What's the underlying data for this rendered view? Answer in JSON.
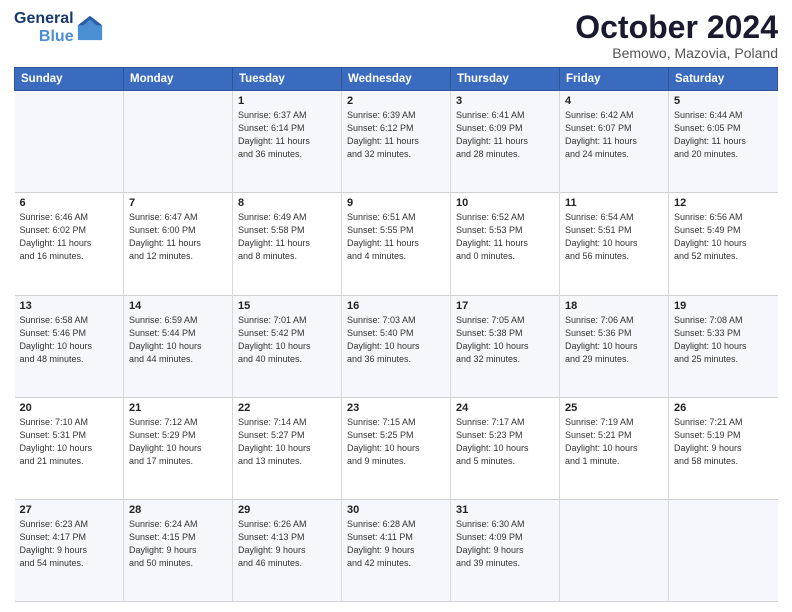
{
  "logo": {
    "text_general": "General",
    "text_blue": "Blue"
  },
  "header": {
    "title": "October 2024",
    "subtitle": "Bemowo, Mazovia, Poland"
  },
  "days_of_week": [
    "Sunday",
    "Monday",
    "Tuesday",
    "Wednesday",
    "Thursday",
    "Friday",
    "Saturday"
  ],
  "weeks": [
    [
      {
        "day": "",
        "content": ""
      },
      {
        "day": "",
        "content": ""
      },
      {
        "day": "1",
        "content": "Sunrise: 6:37 AM\nSunset: 6:14 PM\nDaylight: 11 hours\nand 36 minutes."
      },
      {
        "day": "2",
        "content": "Sunrise: 6:39 AM\nSunset: 6:12 PM\nDaylight: 11 hours\nand 32 minutes."
      },
      {
        "day": "3",
        "content": "Sunrise: 6:41 AM\nSunset: 6:09 PM\nDaylight: 11 hours\nand 28 minutes."
      },
      {
        "day": "4",
        "content": "Sunrise: 6:42 AM\nSunset: 6:07 PM\nDaylight: 11 hours\nand 24 minutes."
      },
      {
        "day": "5",
        "content": "Sunrise: 6:44 AM\nSunset: 6:05 PM\nDaylight: 11 hours\nand 20 minutes."
      }
    ],
    [
      {
        "day": "6",
        "content": "Sunrise: 6:46 AM\nSunset: 6:02 PM\nDaylight: 11 hours\nand 16 minutes."
      },
      {
        "day": "7",
        "content": "Sunrise: 6:47 AM\nSunset: 6:00 PM\nDaylight: 11 hours\nand 12 minutes."
      },
      {
        "day": "8",
        "content": "Sunrise: 6:49 AM\nSunset: 5:58 PM\nDaylight: 11 hours\nand 8 minutes."
      },
      {
        "day": "9",
        "content": "Sunrise: 6:51 AM\nSunset: 5:55 PM\nDaylight: 11 hours\nand 4 minutes."
      },
      {
        "day": "10",
        "content": "Sunrise: 6:52 AM\nSunset: 5:53 PM\nDaylight: 11 hours\nand 0 minutes."
      },
      {
        "day": "11",
        "content": "Sunrise: 6:54 AM\nSunset: 5:51 PM\nDaylight: 10 hours\nand 56 minutes."
      },
      {
        "day": "12",
        "content": "Sunrise: 6:56 AM\nSunset: 5:49 PM\nDaylight: 10 hours\nand 52 minutes."
      }
    ],
    [
      {
        "day": "13",
        "content": "Sunrise: 6:58 AM\nSunset: 5:46 PM\nDaylight: 10 hours\nand 48 minutes."
      },
      {
        "day": "14",
        "content": "Sunrise: 6:59 AM\nSunset: 5:44 PM\nDaylight: 10 hours\nand 44 minutes."
      },
      {
        "day": "15",
        "content": "Sunrise: 7:01 AM\nSunset: 5:42 PM\nDaylight: 10 hours\nand 40 minutes."
      },
      {
        "day": "16",
        "content": "Sunrise: 7:03 AM\nSunset: 5:40 PM\nDaylight: 10 hours\nand 36 minutes."
      },
      {
        "day": "17",
        "content": "Sunrise: 7:05 AM\nSunset: 5:38 PM\nDaylight: 10 hours\nand 32 minutes."
      },
      {
        "day": "18",
        "content": "Sunrise: 7:06 AM\nSunset: 5:36 PM\nDaylight: 10 hours\nand 29 minutes."
      },
      {
        "day": "19",
        "content": "Sunrise: 7:08 AM\nSunset: 5:33 PM\nDaylight: 10 hours\nand 25 minutes."
      }
    ],
    [
      {
        "day": "20",
        "content": "Sunrise: 7:10 AM\nSunset: 5:31 PM\nDaylight: 10 hours\nand 21 minutes."
      },
      {
        "day": "21",
        "content": "Sunrise: 7:12 AM\nSunset: 5:29 PM\nDaylight: 10 hours\nand 17 minutes."
      },
      {
        "day": "22",
        "content": "Sunrise: 7:14 AM\nSunset: 5:27 PM\nDaylight: 10 hours\nand 13 minutes."
      },
      {
        "day": "23",
        "content": "Sunrise: 7:15 AM\nSunset: 5:25 PM\nDaylight: 10 hours\nand 9 minutes."
      },
      {
        "day": "24",
        "content": "Sunrise: 7:17 AM\nSunset: 5:23 PM\nDaylight: 10 hours\nand 5 minutes."
      },
      {
        "day": "25",
        "content": "Sunrise: 7:19 AM\nSunset: 5:21 PM\nDaylight: 10 hours\nand 1 minute."
      },
      {
        "day": "26",
        "content": "Sunrise: 7:21 AM\nSunset: 5:19 PM\nDaylight: 9 hours\nand 58 minutes."
      }
    ],
    [
      {
        "day": "27",
        "content": "Sunrise: 6:23 AM\nSunset: 4:17 PM\nDaylight: 9 hours\nand 54 minutes."
      },
      {
        "day": "28",
        "content": "Sunrise: 6:24 AM\nSunset: 4:15 PM\nDaylight: 9 hours\nand 50 minutes."
      },
      {
        "day": "29",
        "content": "Sunrise: 6:26 AM\nSunset: 4:13 PM\nDaylight: 9 hours\nand 46 minutes."
      },
      {
        "day": "30",
        "content": "Sunrise: 6:28 AM\nSunset: 4:11 PM\nDaylight: 9 hours\nand 42 minutes."
      },
      {
        "day": "31",
        "content": "Sunrise: 6:30 AM\nSunset: 4:09 PM\nDaylight: 9 hours\nand 39 minutes."
      },
      {
        "day": "",
        "content": ""
      },
      {
        "day": "",
        "content": ""
      }
    ]
  ]
}
